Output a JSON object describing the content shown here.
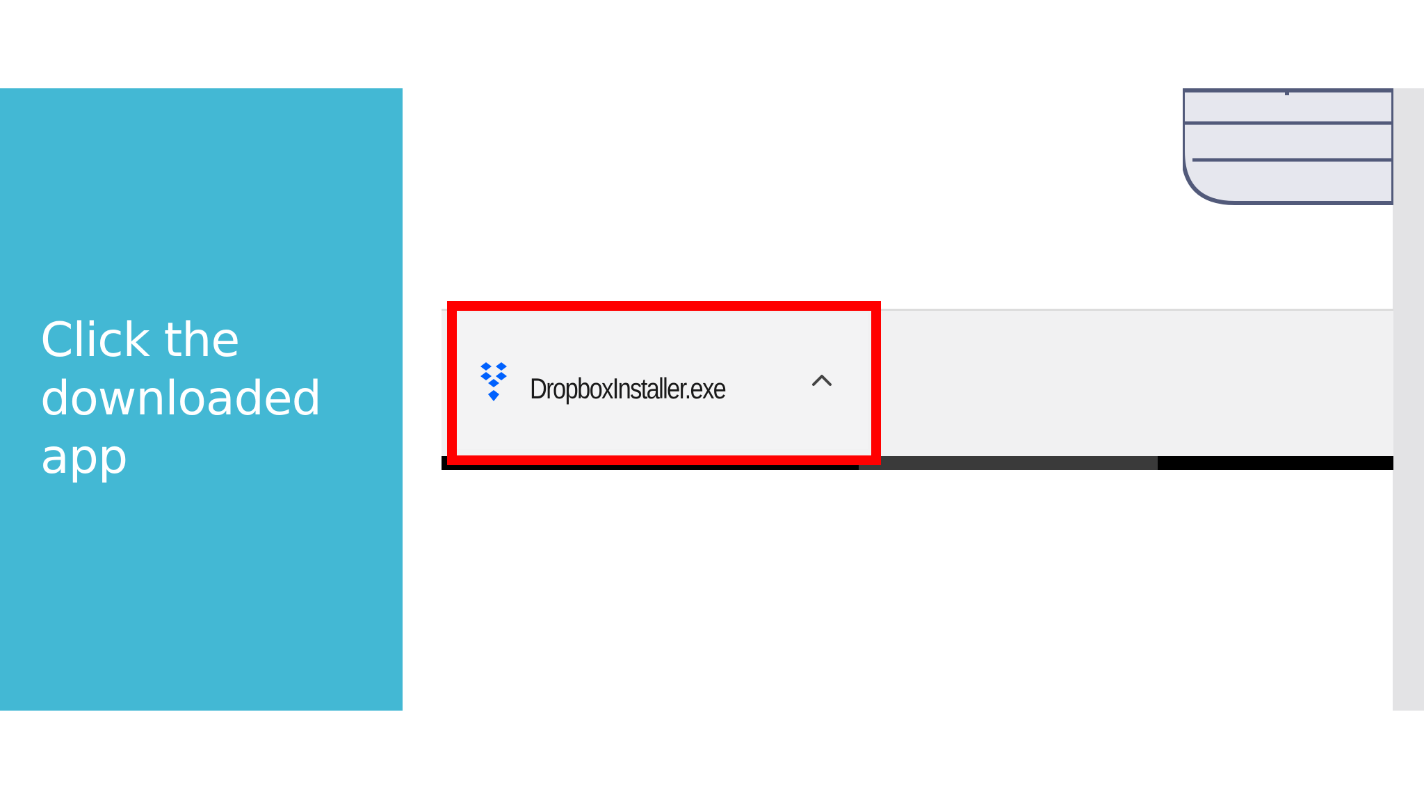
{
  "slide": {
    "title_lines": [
      "Click the",
      "downloaded",
      "app"
    ]
  },
  "download_shelf": {
    "item": {
      "file_name": "DropboxInstaller.exe",
      "icon": "dropbox-icon",
      "menu_icon": "chevron-up-icon"
    }
  },
  "colors": {
    "accent_panel": "#43b8d4",
    "highlight": "#ff0000",
    "dropbox_blue": "#0061fe"
  }
}
